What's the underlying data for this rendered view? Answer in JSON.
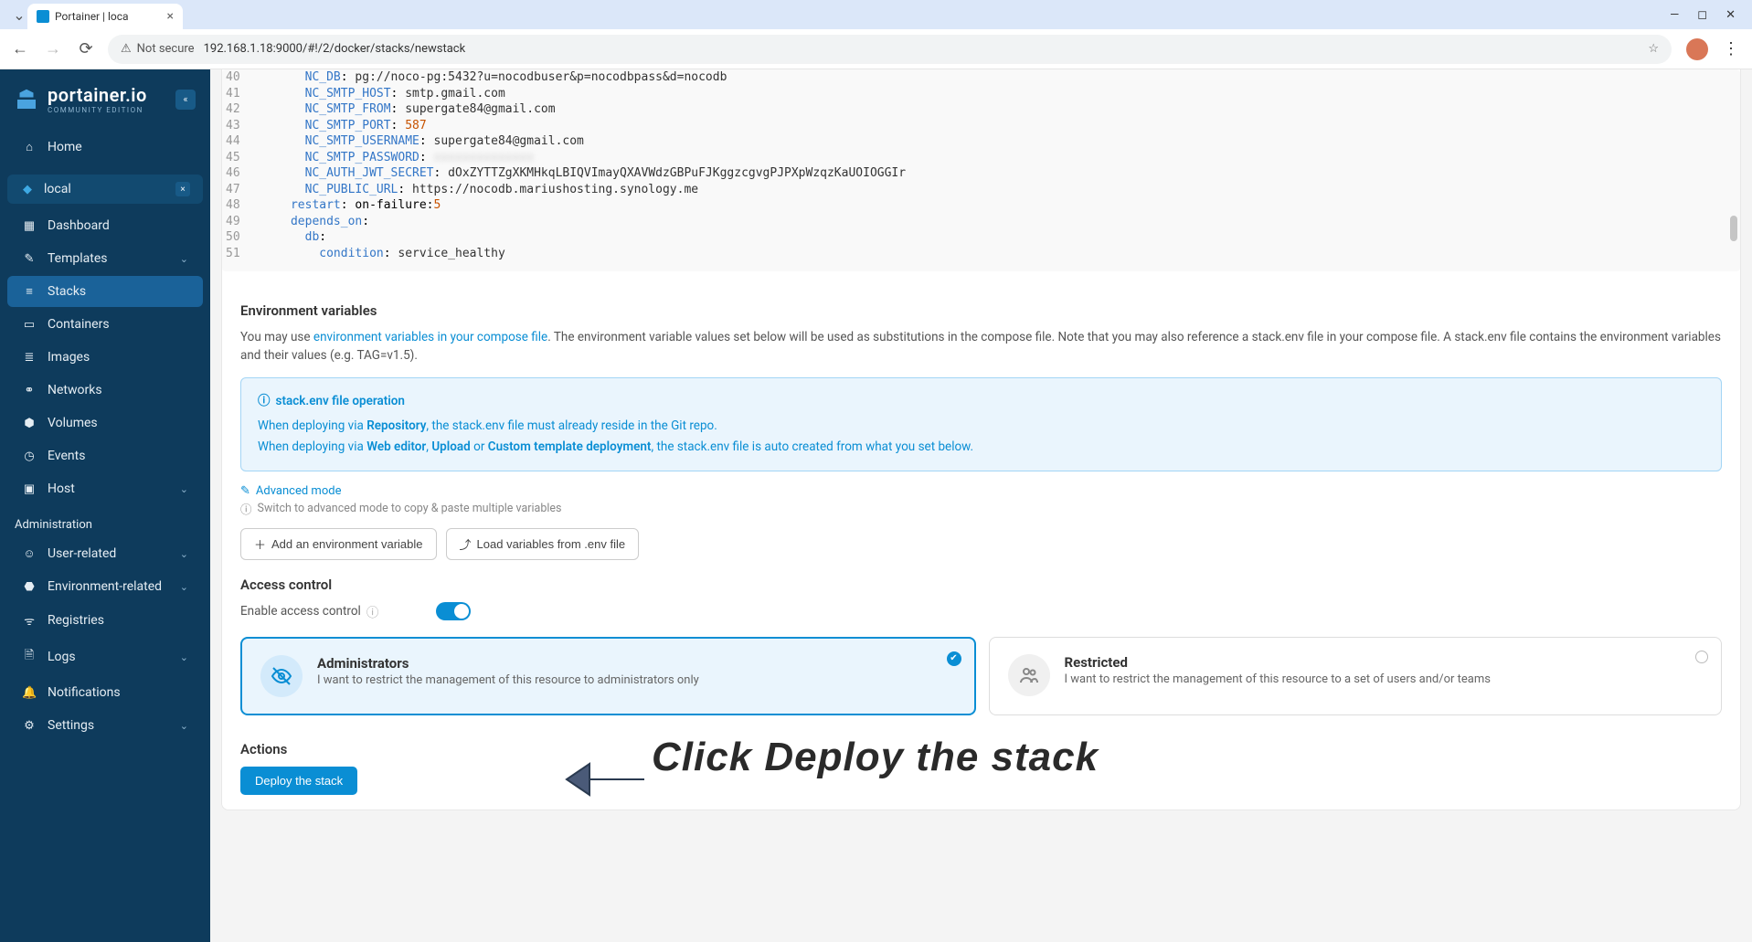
{
  "browser": {
    "tabTitle": "Portainer | loca",
    "securityLabel": "Not secure",
    "url": "192.168.1.18:9000/#!/2/docker/stacks/newstack"
  },
  "sidebar": {
    "brand": "portainer.io",
    "edition": "Community Edition",
    "home": "Home",
    "env": "local",
    "items": [
      {
        "label": "Dashboard"
      },
      {
        "label": "Templates"
      },
      {
        "label": "Stacks"
      },
      {
        "label": "Containers"
      },
      {
        "label": "Images"
      },
      {
        "label": "Networks"
      },
      {
        "label": "Volumes"
      },
      {
        "label": "Events"
      },
      {
        "label": "Host"
      }
    ],
    "adminHeader": "Administration",
    "admin": [
      {
        "label": "User-related"
      },
      {
        "label": "Environment-related"
      },
      {
        "label": "Registries"
      },
      {
        "label": "Logs"
      },
      {
        "label": "Notifications"
      },
      {
        "label": "Settings"
      }
    ]
  },
  "code": {
    "startLine": 40,
    "lines": [
      {
        "indent": 6,
        "key": "NC_DB",
        "val": "pg://noco-pg:5432?u=nocodbuser&p=nocodbpass&d=nocodb"
      },
      {
        "indent": 6,
        "key": "NC_SMTP_HOST",
        "val": "smtp.gmail.com"
      },
      {
        "indent": 6,
        "key": "NC_SMTP_FROM",
        "val": "supergate84@gmail.com"
      },
      {
        "indent": 6,
        "key": "NC_SMTP_PORT",
        "val": "587",
        "num": true
      },
      {
        "indent": 6,
        "key": "NC_SMTP_USERNAME",
        "val": "supergate84@gmail.com"
      },
      {
        "indent": 6,
        "key": "NC_SMTP_PASSWORD",
        "val": "xxxxxxxxxxxxxx",
        "hide": true
      },
      {
        "indent": 6,
        "key": "NC_AUTH_JWT_SECRET",
        "val": "dOxZYTTZgXKMHkqLBIQVImayQXAVWdzGBPuFJKggzcgvgPJPXpWzqzKaUOIOGGIr"
      },
      {
        "indent": 6,
        "key": "NC_PUBLIC_URL",
        "val": "https://nocodb.mariushosting.synology.me"
      },
      {
        "indent": 4,
        "key": "restart",
        "val": "on-failure:5",
        "numpart": true
      },
      {
        "indent": 4,
        "key": "depends_on",
        "val": ""
      },
      {
        "indent": 6,
        "key": "db",
        "val": ""
      },
      {
        "indent": 8,
        "key": "condition",
        "val": "service_healthy"
      }
    ]
  },
  "env": {
    "title": "Environment variables",
    "help1a": "You may use ",
    "help1Link": "environment variables in your compose file",
    "help1b": ". The environment variable values set below will be used as substitutions in the compose file. Note that you may also reference a stack.env file in your compose file. A stack.env file contains the environment variables and their values (e.g. TAG=v1.5).",
    "infoTitle": "stack.env file operation",
    "infoL1a": "When deploying via ",
    "infoL1b": "Repository",
    "infoL1c": ", the stack.env file must already reside in the Git repo.",
    "infoL2a": "When deploying via ",
    "infoL2b": "Web editor",
    "infoL2c": ", ",
    "infoL2d": "Upload",
    "infoL2e": " or ",
    "infoL2f": "Custom template deployment",
    "infoL2g": ", the stack.env file is auto created from what you set below.",
    "advanced": "Advanced mode",
    "advHint": "Switch to advanced mode to copy & paste multiple variables",
    "addBtn": "Add an environment variable",
    "loadBtn": "Load variables from .env file"
  },
  "access": {
    "title": "Access control",
    "toggleLabel": "Enable access control",
    "adminTitle": "Administrators",
    "adminDesc": "I want to restrict the management of this resource to administrators only",
    "restrTitle": "Restricted",
    "restrDesc": "I want to restrict the management of this resource to a set of users and/or teams"
  },
  "actions": {
    "title": "Actions",
    "deployBtn": "Deploy the stack"
  },
  "annotation": {
    "text": "Click Deploy the stack"
  }
}
